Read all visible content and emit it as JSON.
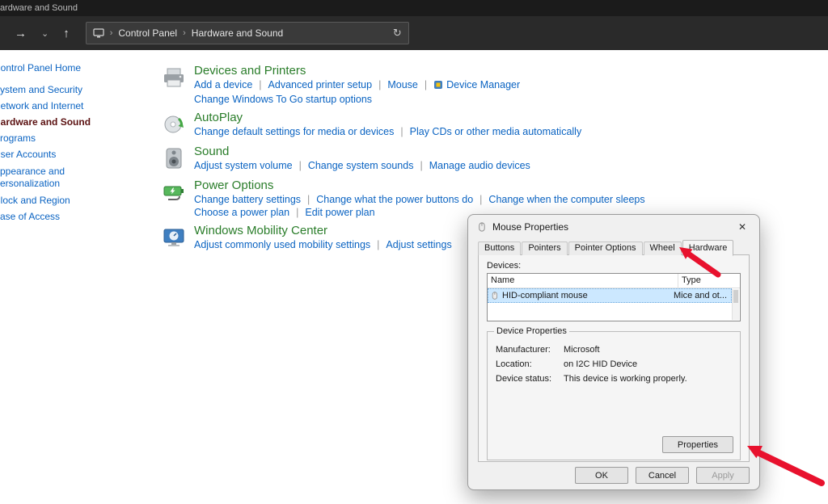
{
  "window": {
    "title": "Hardware and Sound"
  },
  "icons": {
    "back": "→",
    "chevron_down": "⌄",
    "up": "↑",
    "crumb_chevron": "›",
    "refresh": "↻",
    "close": "✕"
  },
  "nav": {
    "breadcrumb": [
      "Control Panel",
      "Hardware and Sound"
    ]
  },
  "sidebar": {
    "items": [
      {
        "label": "Control Panel Home"
      },
      {
        "label": "System and Security"
      },
      {
        "label": "Network and Internet"
      },
      {
        "label": "Hardware and Sound"
      },
      {
        "label": "Programs"
      },
      {
        "label": "User Accounts"
      },
      {
        "label": "Appearance and Personalization"
      },
      {
        "label": "Clock and Region"
      },
      {
        "label": "Ease of Access"
      }
    ]
  },
  "main": {
    "sections": [
      {
        "title": "Devices and Printers",
        "icon": "devices-and-printers-icon",
        "rows": [
          {
            "links": [
              "Add a device",
              "Advanced printer setup",
              "Mouse",
              "Device Manager"
            ]
          },
          {
            "links": [
              "Change Windows To Go startup options"
            ]
          }
        ]
      },
      {
        "title": "AutoPlay",
        "icon": "autoplay-icon",
        "rows": [
          {
            "links": [
              "Change default settings for media or devices",
              "Play CDs or other media automatically"
            ]
          }
        ]
      },
      {
        "title": "Sound",
        "icon": "sound-icon",
        "rows": [
          {
            "links": [
              "Adjust system volume",
              "Change system sounds",
              "Manage audio devices"
            ]
          }
        ]
      },
      {
        "title": "Power Options",
        "icon": "power-options-icon",
        "rows": [
          {
            "links": [
              "Change battery settings",
              "Change what the power buttons do",
              "Change when the computer sleeps"
            ]
          },
          {
            "links": [
              "Choose a power plan",
              "Edit power plan"
            ]
          }
        ]
      },
      {
        "title": "Windows Mobility Center",
        "icon": "mobility-center-icon",
        "rows": [
          {
            "links": [
              "Adjust commonly used mobility settings",
              "Adjust settings"
            ]
          }
        ]
      }
    ]
  },
  "dialog": {
    "title": "Mouse Properties",
    "tabs": [
      "Buttons",
      "Pointers",
      "Pointer Options",
      "Wheel",
      "Hardware"
    ],
    "active_tab": "Hardware",
    "devices_label": "Devices:",
    "table": {
      "columns": [
        "Name",
        "Type"
      ],
      "rows": [
        {
          "name": "HID-compliant mouse",
          "type": "Mice and ot..."
        }
      ]
    },
    "group": {
      "title": "Device Properties",
      "fields": [
        {
          "label": "Manufacturer:",
          "value": "Microsoft"
        },
        {
          "label": "Location:",
          "value": "on I2C HID Device"
        },
        {
          "label": "Device status:",
          "value": "This device is working properly."
        }
      ]
    },
    "properties_button": "Properties",
    "buttons": {
      "ok": "OK",
      "cancel": "Cancel",
      "apply": "Apply"
    }
  },
  "colors": {
    "heading_green": "#2a7d2a",
    "link_blue": "#0a63c2",
    "active_sidebar_item": "#5a1010",
    "selection_blue": "#cce8ff",
    "arrow_red": "#e8112d"
  }
}
